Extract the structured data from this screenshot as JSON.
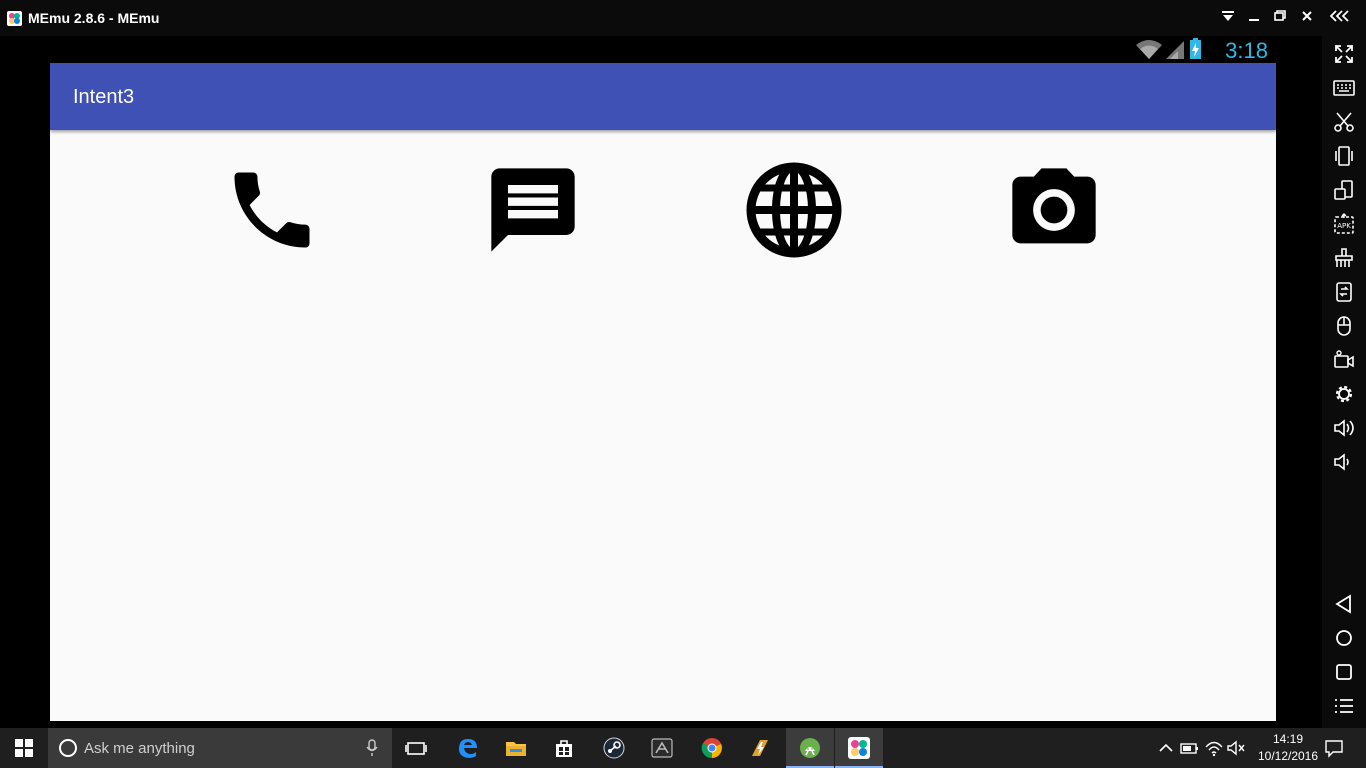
{
  "window": {
    "title": "MEmu 2.8.6 - MEmu",
    "controls": [
      "dropdown-icon",
      "minimize-icon",
      "restore-icon",
      "close-icon",
      "collapse-sidebar-icon"
    ]
  },
  "android": {
    "status_clock": "3:18",
    "app_title": "Intent3",
    "accent": "#3f51b5",
    "actions": [
      "phone-icon",
      "message-icon",
      "globe-icon",
      "camera-icon"
    ]
  },
  "sidebar": {
    "tools": [
      "fullscreen-icon",
      "keyboard-icon",
      "scissors-icon",
      "shake-icon",
      "rotate-icon",
      "apk-icon",
      "cleanup-icon",
      "transfer-icon",
      "mouse-icon",
      "video-record-icon",
      "settings-icon",
      "volume-up-icon",
      "volume-down-icon"
    ],
    "nav": [
      "back-icon",
      "home-icon",
      "recents-icon",
      "menu-icon"
    ]
  },
  "taskbar": {
    "search_placeholder": "Ask me anything",
    "clock_time": "14:19",
    "clock_date": "10/12/2016"
  }
}
